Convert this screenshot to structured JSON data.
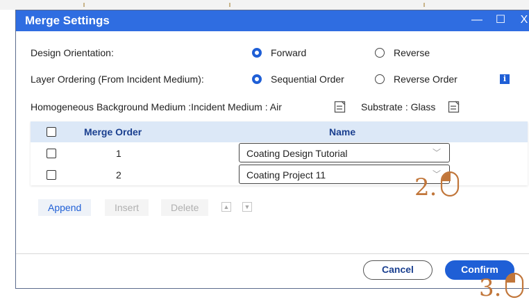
{
  "dialog": {
    "title": "Merge Settings",
    "window_controls": {
      "minimize": "—",
      "maximize": "☐",
      "close": "X"
    }
  },
  "design_orientation": {
    "label": "Design Orientation:",
    "options": [
      {
        "label": "Forward",
        "selected": true
      },
      {
        "label": "Reverse",
        "selected": false
      }
    ]
  },
  "layer_ordering": {
    "label": "Layer Ordering (From Incident Medium):",
    "options": [
      {
        "label": "Sequential Order",
        "selected": true
      },
      {
        "label": "Reverse Order",
        "selected": false
      }
    ],
    "info_icon": "info-icon"
  },
  "background_medium": {
    "label": "Homogeneous Background Medium :Incident Medium : Air",
    "substrate_label": "Substrate : Glass",
    "edit_icon": "edit-icon"
  },
  "table": {
    "columns": [
      "Merge Order",
      "Name"
    ],
    "rows": [
      {
        "order": "1",
        "name": "Coating Design Tutorial",
        "checked": false
      },
      {
        "order": "2",
        "name": "Coating Project 11",
        "checked": false
      }
    ]
  },
  "actions": {
    "append": "Append",
    "insert": "Insert",
    "delete": "Delete",
    "move_up_icon": "arrow-up-icon",
    "move_down_icon": "arrow-down-icon"
  },
  "footer": {
    "cancel": "Cancel",
    "confirm": "Confirm"
  },
  "annotations": {
    "step2": "2.",
    "step3": "3.",
    "color": "#c1763a"
  },
  "colors": {
    "accent": "#1f5fd6",
    "title_bar": "#2f6de1",
    "header_row": "#dce8f7"
  }
}
